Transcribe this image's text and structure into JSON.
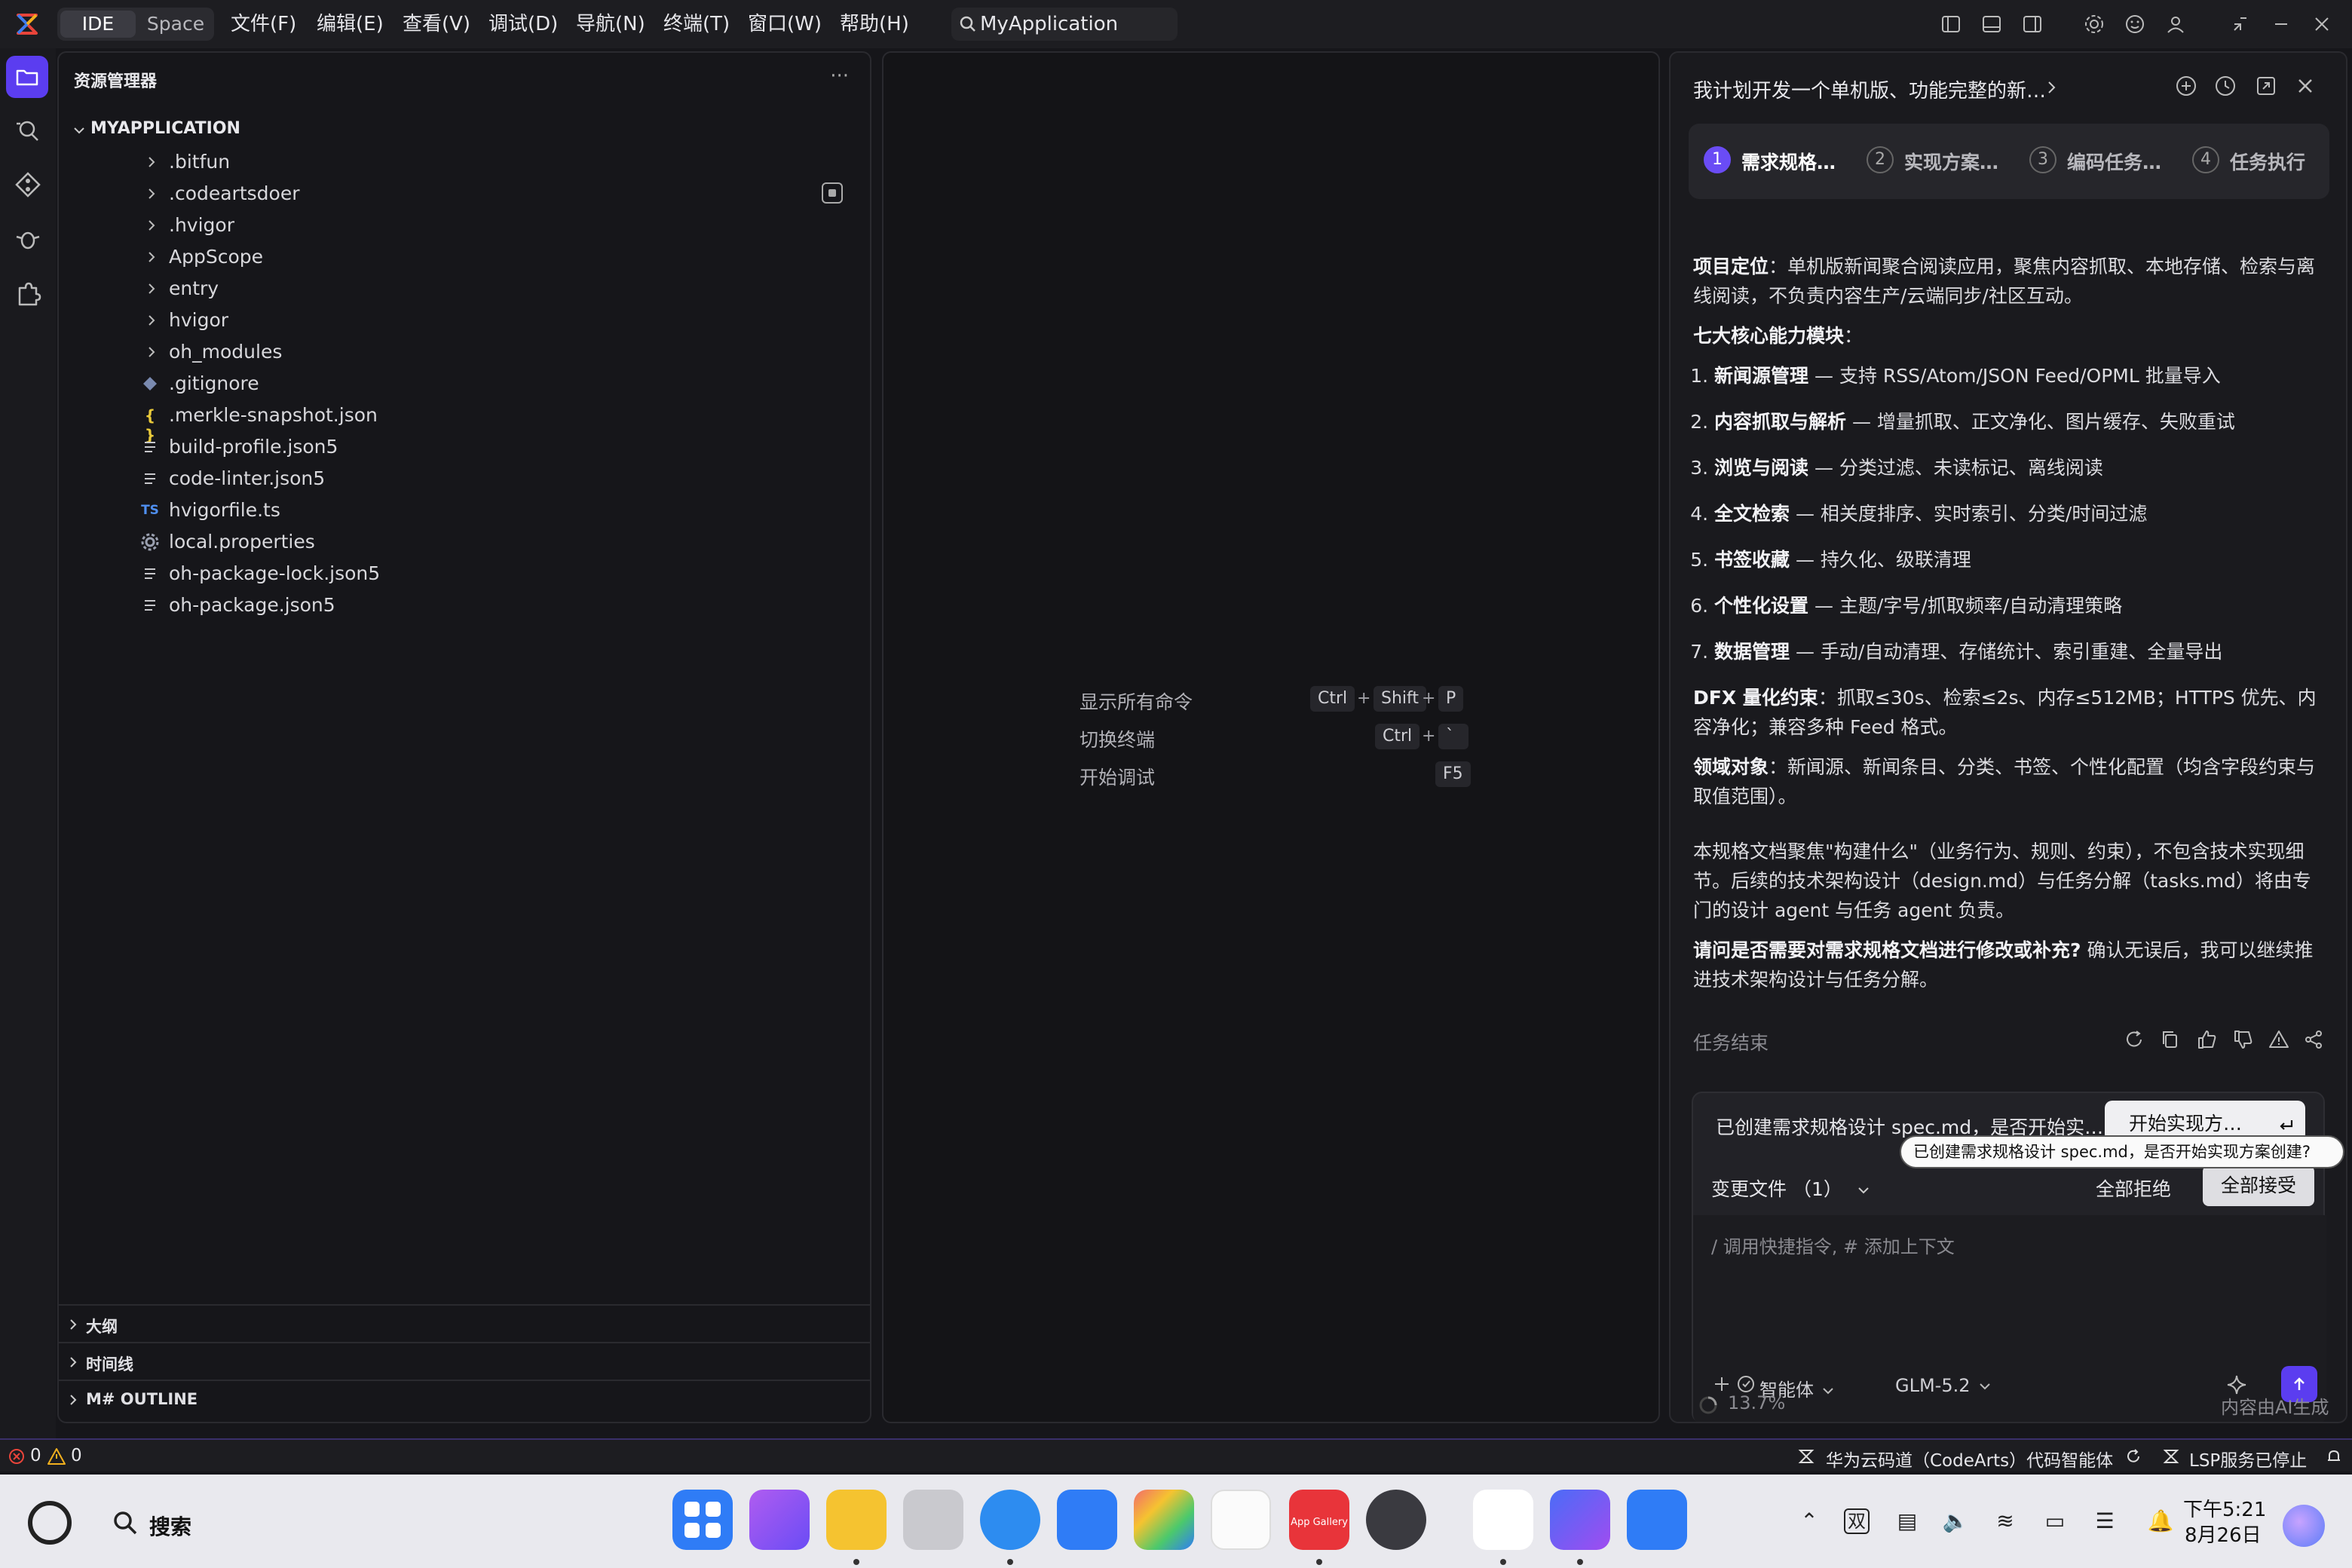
{
  "titlebar": {
    "mode_ide": "IDE",
    "mode_space": "Space",
    "menus": [
      "文件(F)",
      "编辑(E)",
      "查看(V)",
      "调试(D)",
      "导航(N)",
      "终端(T)",
      "窗口(W)",
      "帮助(H)"
    ],
    "search": "MyApplication"
  },
  "explorer": {
    "title": "资源管理器",
    "more": "···",
    "root": "MYAPPLICATION",
    "folders": [
      ".bitfun",
      ".codeartsdoer",
      ".hvigor",
      "AppScope",
      "entry",
      "hvigor",
      "oh_modules"
    ],
    "files": [
      {
        "name": ".gitignore",
        "icon": "git-icon"
      },
      {
        "name": ".merkle-snapshot.json",
        "icon": "json-icon",
        "glyph": "{ }"
      },
      {
        "name": "build-profile.json5",
        "icon": "file-lines-icon"
      },
      {
        "name": "code-linter.json5",
        "icon": "file-lines-icon"
      },
      {
        "name": "hvigorfile.ts",
        "icon": "typescript-icon",
        "glyph": "TS"
      },
      {
        "name": "local.properties",
        "icon": "gear-icon"
      },
      {
        "name": "oh-package-lock.json5",
        "icon": "file-lines-icon"
      },
      {
        "name": "oh-package.json5",
        "icon": "file-lines-icon"
      }
    ],
    "sections": [
      "大纲",
      "时间线",
      "M# OUTLINE"
    ]
  },
  "editor": {
    "commands": [
      {
        "label": "显示所有命令",
        "keys": [
          "Ctrl",
          "Shift",
          "P"
        ]
      },
      {
        "label": "切换终端",
        "keys": [
          "Ctrl",
          "`"
        ]
      },
      {
        "label": "开始调试",
        "keys": [
          "F5"
        ]
      }
    ]
  },
  "chat": {
    "title": "我计划开发一个单机版、功能完整的新…",
    "steps": [
      {
        "num": "1",
        "label": "需求规格…",
        "active": true
      },
      {
        "num": "2",
        "label": "实现方案…",
        "active": false
      },
      {
        "num": "3",
        "label": "编码任务…",
        "active": false
      },
      {
        "num": "4",
        "label": "任务执行",
        "active": false
      }
    ],
    "positioning_label": "项目定位",
    "positioning_text": "：单机版新闻聚合阅读应用，聚焦内容抓取、本地存储、检索与离线阅读，不负责内容生产/云端同步/社区互动。",
    "modules_heading": "七大核心能力模块",
    "modules_colon": "：",
    "modules": [
      {
        "name": "新闻源管理",
        "desc": " — 支持 RSS/Atom/JSON Feed/OPML 批量导入"
      },
      {
        "name": "内容抓取与解析",
        "desc": " — 增量抓取、正文净化、图片缓存、失败重试"
      },
      {
        "name": "浏览与阅读",
        "desc": " — 分类过滤、未读标记、离线阅读"
      },
      {
        "name": "全文检索",
        "desc": " — 相关度排序、实时索引、分类/时间过滤"
      },
      {
        "name": "书签收藏",
        "desc": " — 持久化、级联清理"
      },
      {
        "name": "个性化设置",
        "desc": " — 主题/字号/抓取频率/自动清理策略"
      },
      {
        "name": "数据管理",
        "desc": " — 手动/自动清理、存储统计、索引重建、全量导出"
      }
    ],
    "dfx_label": "DFX 量化约束",
    "dfx_text": "：抓取≤30s、检索≤2s、内存≤512MB；HTTPS 优先、内容净化；兼容多种 Feed 格式。",
    "domain_label": "领域对象",
    "domain_text": "：新闻源、新闻条目、分类、书签、个性化配置（均含字段约束与取值范围）。",
    "scope_text": "本规格文档聚焦\"构建什么\"（业务行为、规则、约束），不包含技术实现细节。后续的技术架构设计（design.md）与任务分解（tasks.md）将由专门的设计 agent 与任务 agent 负责。",
    "question_label": "请问是否需要对需求规格文档进行修改或补充?",
    "question_text": " 确认无误后，我可以继续推进技术架构设计与任务分解。",
    "end_label": "任务结束",
    "diff_message": "已创建需求规格设计 spec.md，是否开始实…",
    "start_button": "开始实现方…",
    "tooltip": "已创建需求规格设计 spec.md，是否开始实现方案创建?",
    "changed_files": "变更文件 （1）",
    "reject_all": "全部拒绝",
    "accept_all": "全部接受",
    "input_placeholder": "/ 调用快捷指令, # 添加上下文",
    "agent": "智能体",
    "model": "GLM-5.2",
    "progress": "13.7%",
    "ai_note": "内容由AI生成"
  },
  "statusbar": {
    "errors": "0",
    "warnings": "0",
    "agent_status": "华为云码道（CodeArts）代码智能体",
    "lsp_status": "LSP服务已停止"
  },
  "taskbar": {
    "search": "搜索",
    "ime": "双",
    "time": "下午5:21",
    "date": "8月26日",
    "app_gallery_label": "App Gallery"
  },
  "colors": {
    "accent": "#5b3df0",
    "background": "#16161a",
    "taskbar": "#e9e9ee"
  }
}
